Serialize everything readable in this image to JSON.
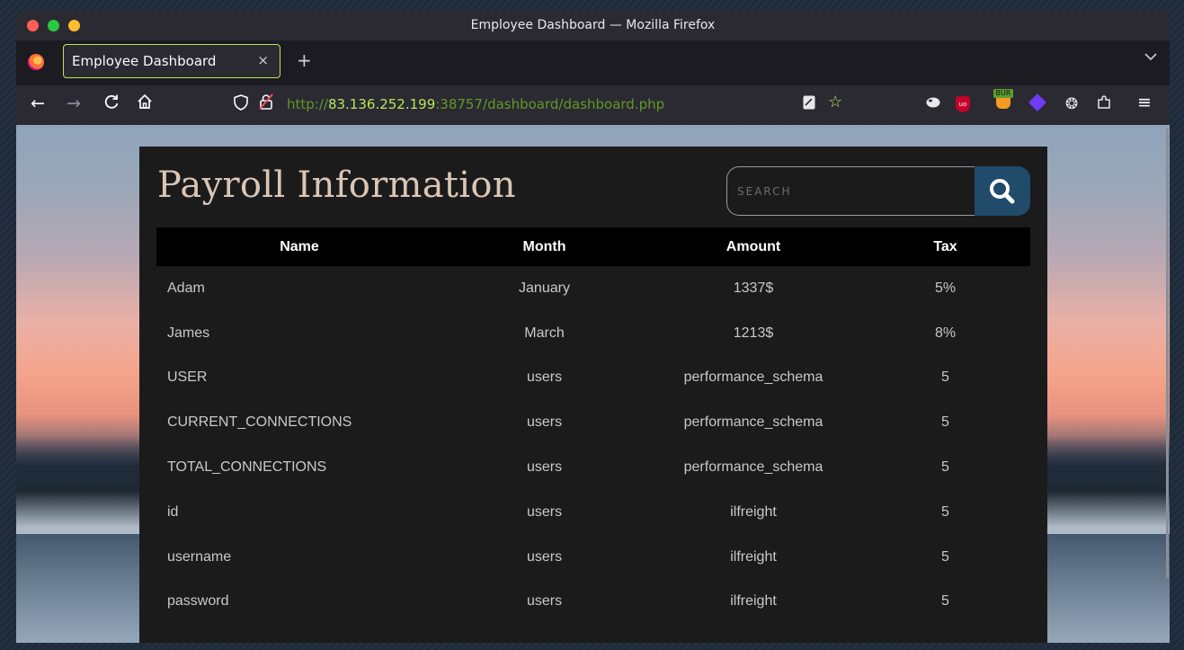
{
  "window": {
    "title": "Employee Dashboard — Mozilla Firefox"
  },
  "tabs": [
    {
      "label": "Employee Dashboard",
      "close": "×",
      "active": true
    }
  ],
  "new_tab_label": "+",
  "tabs_menu_label": "⌄",
  "navigation": {
    "back": "←",
    "forward": "→",
    "reload": "C",
    "home": "⌂",
    "url_scheme": "http://",
    "url_host": "83.136.252.199",
    "url_rest": ":38757/dashboard/dashboard.php"
  },
  "extensions": [
    {
      "name": "extension-icon",
      "glyph": "✎"
    },
    {
      "name": "ublock-origin-icon",
      "glyph": "uo"
    },
    {
      "name": "burp-proxy-icon",
      "glyph": "BUR"
    },
    {
      "name": "diamond-extension-icon",
      "glyph": ""
    },
    {
      "name": "cookie-icon",
      "glyph": "❂"
    },
    {
      "name": "extensions-puzzle-icon",
      "glyph": "⧉"
    }
  ],
  "menu_glyph": "≡",
  "page": {
    "heading": "Payroll Information",
    "search": {
      "placeholder": "SEARCH",
      "value": ""
    },
    "table": {
      "columns": [
        "Name",
        "Month",
        "Amount",
        "Tax"
      ],
      "rows": [
        [
          "Adam",
          "January",
          "1337$",
          "5%"
        ],
        [
          "James",
          "March",
          "1213$",
          "8%"
        ],
        [
          "USER",
          "users",
          "performance_schema",
          "5"
        ],
        [
          "CURRENT_CONNECTIONS",
          "users",
          "performance_schema",
          "5"
        ],
        [
          "TOTAL_CONNECTIONS",
          "users",
          "performance_schema",
          "5"
        ],
        [
          "id",
          "users",
          "ilfreight",
          "5"
        ],
        [
          "username",
          "users",
          "ilfreight",
          "5"
        ],
        [
          "password",
          "users",
          "ilfreight",
          "5"
        ]
      ]
    }
  },
  "colors": {
    "accent": "#b5e853",
    "search_button": "#214b6a",
    "panel": "#1b1b1c",
    "heading": "#d9c6b5"
  }
}
